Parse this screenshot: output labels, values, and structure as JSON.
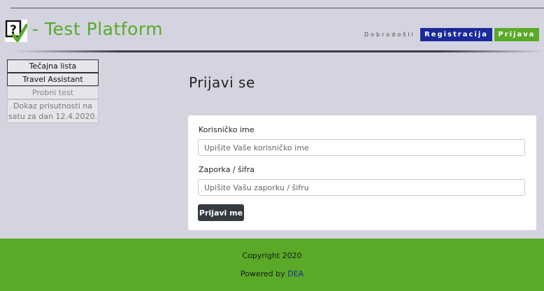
{
  "header": {
    "brand": "- Test Platform",
    "welcome": "Dobrodošli",
    "register_label": "Registracija",
    "login_label": "Prijava"
  },
  "sidebar": {
    "items": [
      {
        "label": "Tečajna lista"
      },
      {
        "label": "Travel Assistant"
      },
      {
        "label": "Probni test"
      },
      {
        "label": "Dokaz prisutnosti na satu za dan 12.4.2020."
      }
    ]
  },
  "main": {
    "title": "Prijavi se",
    "username_label": "Korisničko ime",
    "username_placeholder": "Upišite Vaše korisničko ime",
    "password_label": "Zaporka / šifra",
    "password_placeholder": "Upišite Vašu zaporku / šifru",
    "submit_label": "Prijavi me"
  },
  "footer": {
    "copyright": "Copyright 2020",
    "powered_prefix": "Powered by ",
    "powered_link": "DEA"
  },
  "colors": {
    "background": "#d4d4e0",
    "brand_green": "#5aaa28",
    "brand_blue": "#1a2a9a",
    "dark_button": "#343a40"
  },
  "icons": {
    "logo": "question-check-logo-icon"
  }
}
